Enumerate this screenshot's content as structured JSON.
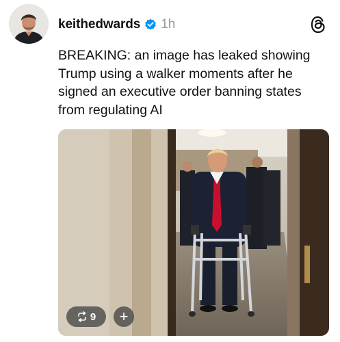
{
  "post": {
    "username": "keithedwards",
    "time": "1h",
    "text": "BREAKING: an image has leaked showing Trump using a walker moments after he signed an executive order banning states from regulating AI",
    "verified_icon": "verified-badge-icon",
    "app_icon": "threads-logo-icon"
  },
  "media": {
    "repost_count": "9",
    "add_label": "+"
  },
  "colors": {
    "verified": "#0095f6",
    "muted": "#9a9a9a",
    "text": "#111111"
  }
}
